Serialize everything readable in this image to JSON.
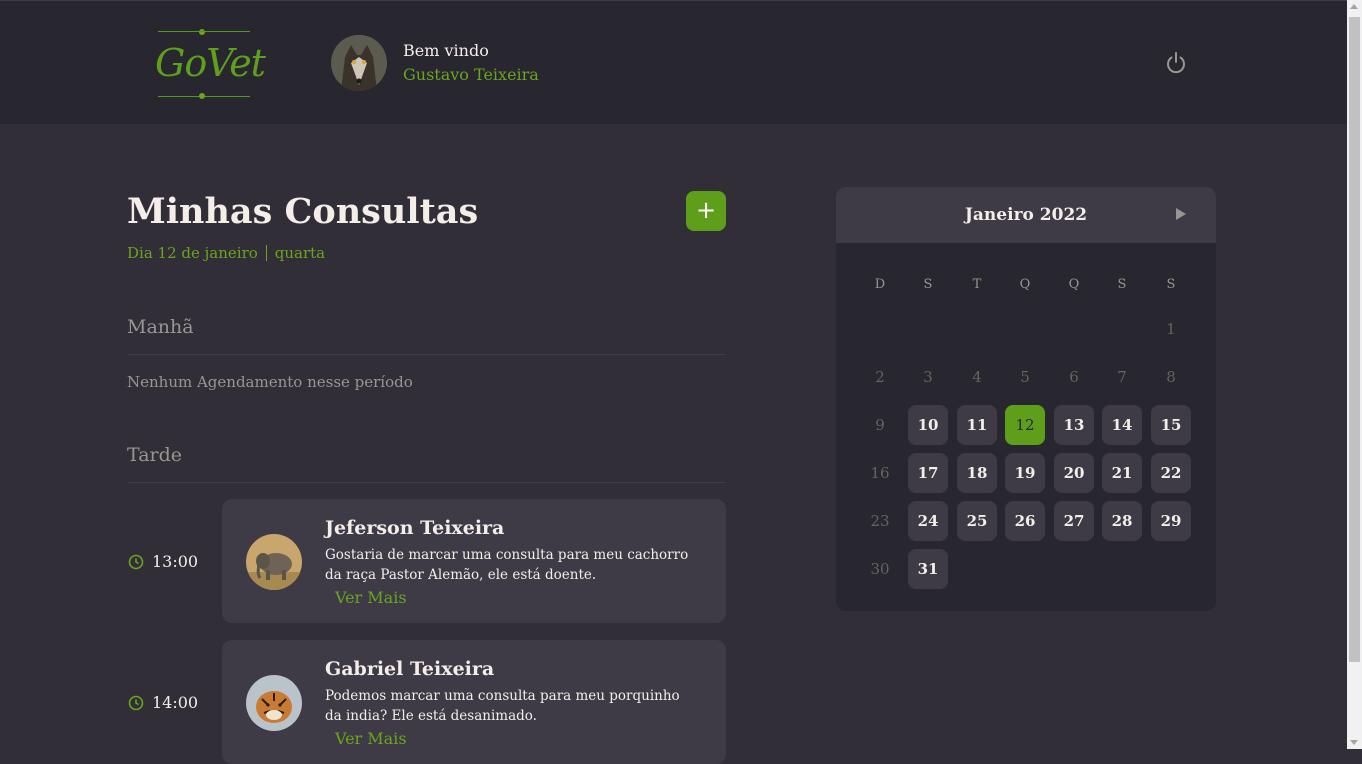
{
  "app": {
    "logo_text": "GoVet"
  },
  "header": {
    "welcome": "Bem vindo",
    "user_name": "Gustavo Teixeira",
    "logout_icon": "power-icon"
  },
  "schedule": {
    "title": "Minhas Consultas",
    "date_label": "Dia 12 de janeiro",
    "weekday": "quarta",
    "add_icon": "plus-icon",
    "add_label": "+",
    "morning": {
      "title": "Manhã",
      "empty_text": "Nenhum Agendamento nesse período"
    },
    "afternoon": {
      "title": "Tarde",
      "appointments": [
        {
          "time": "13:00",
          "name": "Jeferson Teixeira",
          "line1": "Gostaria de marcar uma consulta para meu cachorro",
          "line2": "da raça Pastor Alemão, ele está doente.",
          "more": "Ver Mais"
        },
        {
          "time": "14:00",
          "name": "Gabriel Teixeira",
          "line1": "Podemos marcar uma consulta para meu porquinho",
          "line2": "da india? Ele está desanimado.",
          "more": "Ver Mais"
        }
      ]
    }
  },
  "calendar": {
    "month_label": "Janeiro 2022",
    "weekdays": [
      "D",
      "S",
      "T",
      "Q",
      "Q",
      "S",
      "S"
    ],
    "selected_day": "12",
    "days": [
      "1",
      "2",
      "3",
      "4",
      "5",
      "6",
      "7",
      "8",
      "9",
      "10",
      "11",
      "12",
      "13",
      "14",
      "15",
      "16",
      "17",
      "18",
      "19",
      "20",
      "21",
      "22",
      "23",
      "24",
      "25",
      "26",
      "27",
      "28",
      "29",
      "30",
      "31"
    ]
  },
  "colors": {
    "accent": "#5f9e1a",
    "background": "#312e38",
    "header": "#28262e",
    "card": "#3e3b47"
  }
}
